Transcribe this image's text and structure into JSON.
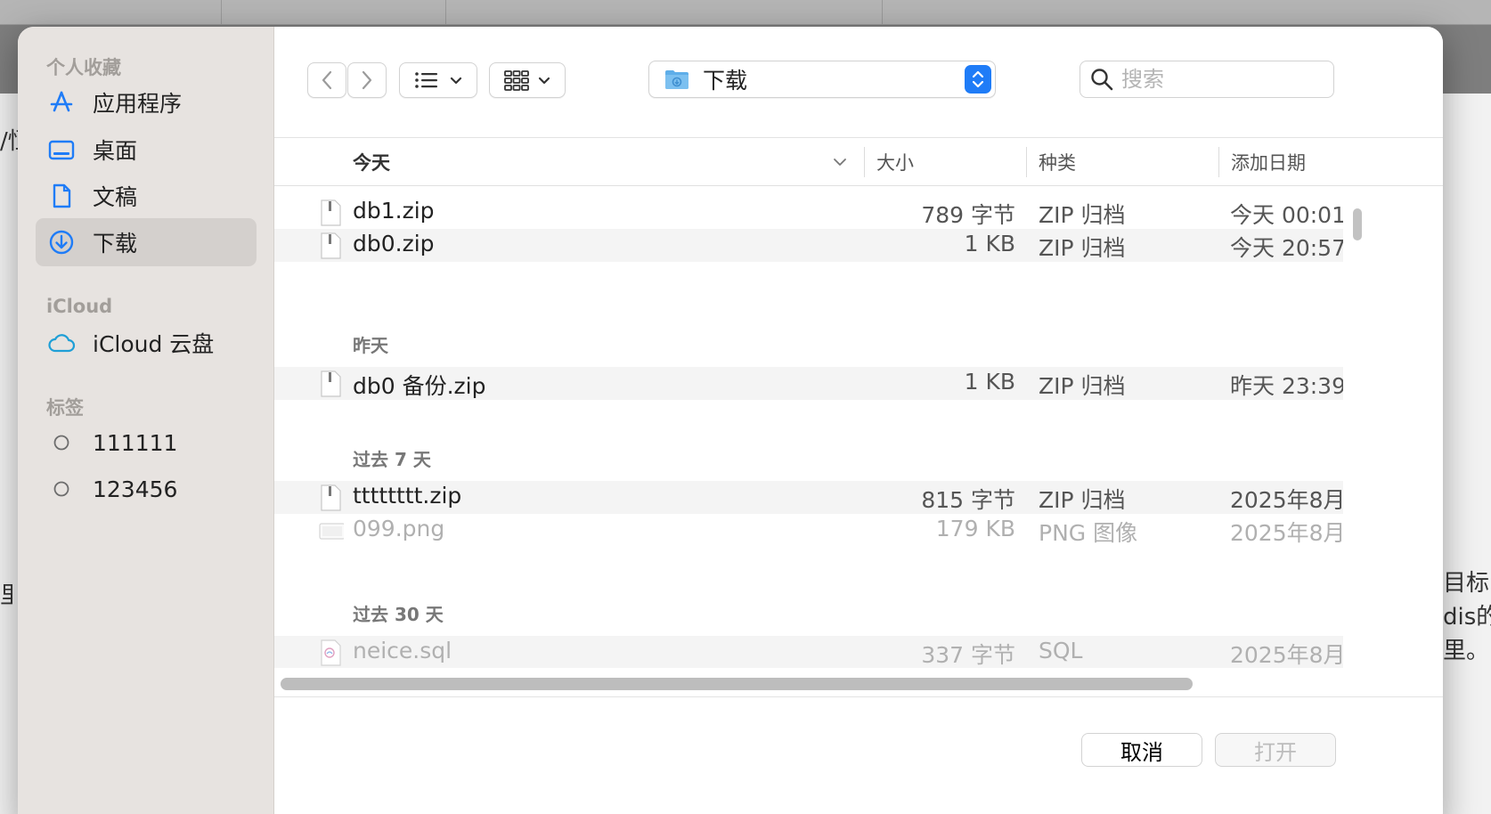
{
  "sidebar": {
    "favorites_heading": "个人收藏",
    "favorites": [
      {
        "label": "应用程序",
        "icon": "app-store-icon"
      },
      {
        "label": "桌面",
        "icon": "desktop-icon"
      },
      {
        "label": "文稿",
        "icon": "document-icon"
      },
      {
        "label": "下载",
        "icon": "download-icon",
        "selected": true
      }
    ],
    "icloud_heading": "iCloud",
    "icloud": [
      {
        "label": "iCloud 云盘",
        "icon": "cloud-icon"
      }
    ],
    "tags_heading": "标签",
    "tags": [
      {
        "label": "111111",
        "icon": "tag-circle-icon"
      },
      {
        "label": "123456",
        "icon": "tag-circle-icon"
      }
    ]
  },
  "toolbar": {
    "location": "下载",
    "search_placeholder": "搜索"
  },
  "columns": {
    "name": "今天",
    "size": "大小",
    "kind": "种类",
    "date": "添加日期"
  },
  "files": [
    {
      "name": "db1.zip",
      "size": "789 字节",
      "kind": "ZIP 归档",
      "date": "今天 00:01",
      "type": "zip",
      "dim": false
    },
    {
      "name": "db0.zip",
      "size": "1 KB",
      "kind": "ZIP 归档",
      "date": "今天 20:57",
      "type": "zip",
      "dim": false
    },
    {
      "group": "昨天"
    },
    {
      "name": "db0 备份.zip",
      "size": "1 KB",
      "kind": "ZIP 归档",
      "date": "昨天 23:39",
      "type": "zip",
      "dim": false
    },
    {
      "group": "过去 7 天"
    },
    {
      "name": "tttttttt.zip",
      "size": "815 字节",
      "kind": "ZIP 归档",
      "date": "2025年8月",
      "type": "zip",
      "dim": false
    },
    {
      "name": "099.png",
      "size": "179 KB",
      "kind": "PNG 图像",
      "date": "2025年8月",
      "type": "png",
      "dim": true
    },
    {
      "group": "过去 30 天"
    },
    {
      "name": "neice.sql",
      "size": "337 字节",
      "kind": "SQL",
      "date": "2025年8月",
      "type": "sql",
      "dim": true
    }
  ],
  "footer": {
    "cancel_label": "取消",
    "open_label": "打开"
  },
  "background": {
    "frag_left_top": "/恒",
    "frag_left_mid": "里",
    "frag_right_1": "目标",
    "frag_right_2": "dis的",
    "frag_right_3": "里。"
  },
  "colors": {
    "accent": "#1f7cf7",
    "sidebar_bg": "#e7e3e0",
    "selected_bg": "#d4d0cd"
  }
}
